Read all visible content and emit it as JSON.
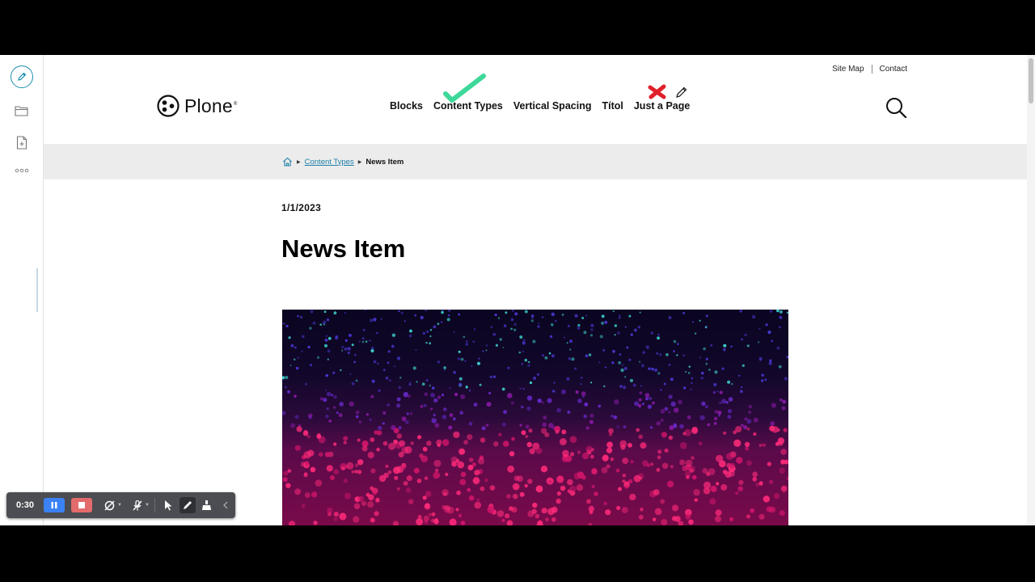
{
  "header": {
    "top_links": [
      "Site Map",
      "Contact"
    ],
    "logo_text": "Plone",
    "logo_reg": "®",
    "nav": [
      "Blocks",
      "Content Types",
      "Vertical Spacing",
      "Títol",
      "Just a Page"
    ]
  },
  "breadcrumb": {
    "link": "Content Types",
    "current": "News Item"
  },
  "content": {
    "date": "1/1/2023",
    "title": "News Item"
  },
  "recorder": {
    "time": "0:30"
  },
  "colors": {
    "accent": "#1a8fb0",
    "check": "#3ed89a",
    "cross": "#e0202a",
    "pause": "#3b82f6",
    "stop": "#e36b6b"
  },
  "icons": {
    "toolbar": [
      "pencil-icon",
      "folder-icon",
      "add-document-icon",
      "more-icon"
    ],
    "recorder": [
      "pause-icon",
      "stop-icon",
      "camera-off-icon",
      "mic-off-icon",
      "pointer-icon",
      "pen-icon",
      "eraser-icon",
      "collapse-icon"
    ]
  }
}
